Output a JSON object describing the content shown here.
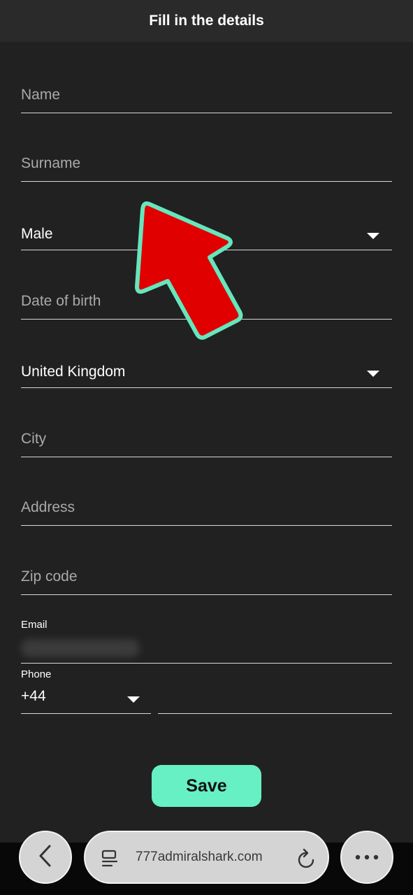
{
  "header": {
    "title": "Fill in the details"
  },
  "form": {
    "name_placeholder": "Name",
    "surname_placeholder": "Surname",
    "gender_value": "Male",
    "dob_placeholder": "Date of birth",
    "country_value": "United Kingdom",
    "city_placeholder": "City",
    "address_placeholder": "Address",
    "zip_placeholder": "Zip code",
    "email_label": "Email",
    "phone_label": "Phone",
    "phone_code": "+44",
    "save_label": "Save"
  },
  "browser": {
    "url": "777admiralshark.com",
    "icons": [
      "back-icon",
      "tabs-icon",
      "reload-icon",
      "more-icon"
    ]
  },
  "colors": {
    "accent": "#66f0c4",
    "background": "#212121",
    "arrow_fill": "#e00000",
    "arrow_stroke": "#66e6bd"
  }
}
